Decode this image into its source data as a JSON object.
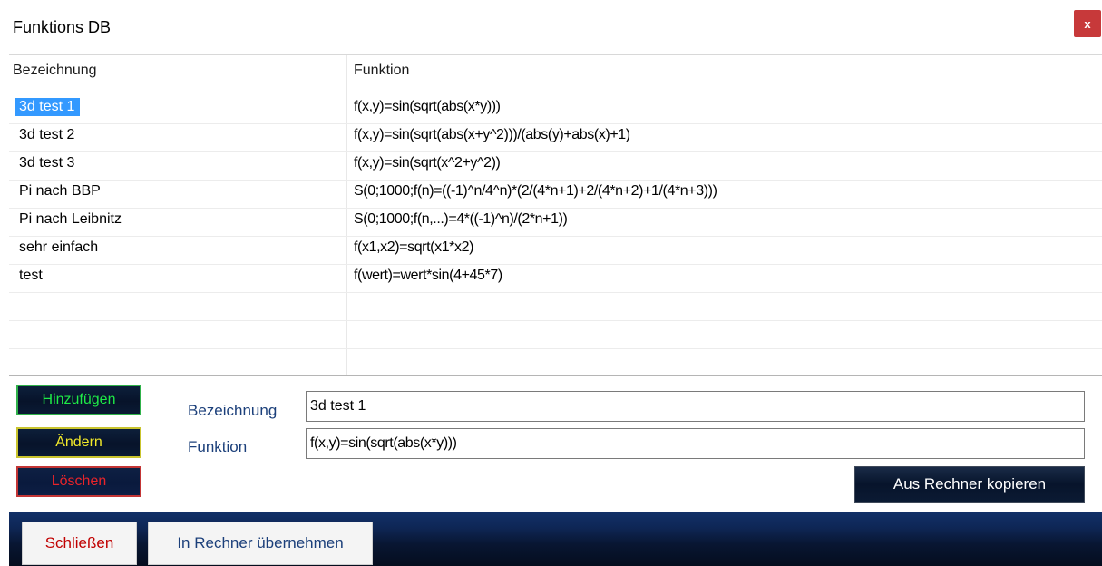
{
  "window": {
    "title": "Funktions DB",
    "close_label": "x"
  },
  "table": {
    "columns": [
      "Bezeichnung",
      "Funktion"
    ],
    "rows": [
      {
        "name": "3d test 1",
        "function": "f(x,y)=sin(sqrt(abs(x*y)))"
      },
      {
        "name": "3d test 2",
        "function": "f(x,y)=sin(sqrt(abs(x+y^2)))/(abs(y)+abs(x)+1)"
      },
      {
        "name": "3d test 3",
        "function": "f(x,y)=sin(sqrt(x^2+y^2))"
      },
      {
        "name": "Pi nach BBP",
        "function": "S(0;1000;f(n)=((-1)^n/4^n)*(2/(4*n+1)+2/(4*n+2)+1/(4*n+3)))"
      },
      {
        "name": "Pi nach Leibnitz",
        "function": "S(0;1000;f(n,...)=4*((-1)^n)/(2*n+1))"
      },
      {
        "name": "sehr einfach",
        "function": "f(x1,x2)=sqrt(x1*x2)"
      },
      {
        "name": "test",
        "function": "f(wert)=wert*sin(4+45*7)"
      }
    ],
    "selected_index": 0
  },
  "actions": {
    "add": "Hinzufügen",
    "change": "Ändern",
    "delete": "Löschen"
  },
  "form": {
    "name_label": "Bezeichnung",
    "name_value": "3d test 1",
    "function_label": "Funktion",
    "function_value": "f(x,y)=sin(sqrt(abs(x*y)))",
    "copy_button": "Aus Rechner kopieren"
  },
  "footer": {
    "close_button": "Schließen",
    "transfer_button": "In Rechner übernehmen"
  },
  "colors": {
    "selection": "#3399ff",
    "add_text": "#1eea47",
    "change_text": "#f2e92a",
    "delete_text": "#e8242a",
    "title_close_bg": "#c7393a",
    "bottom_bar": "#0e2655"
  }
}
